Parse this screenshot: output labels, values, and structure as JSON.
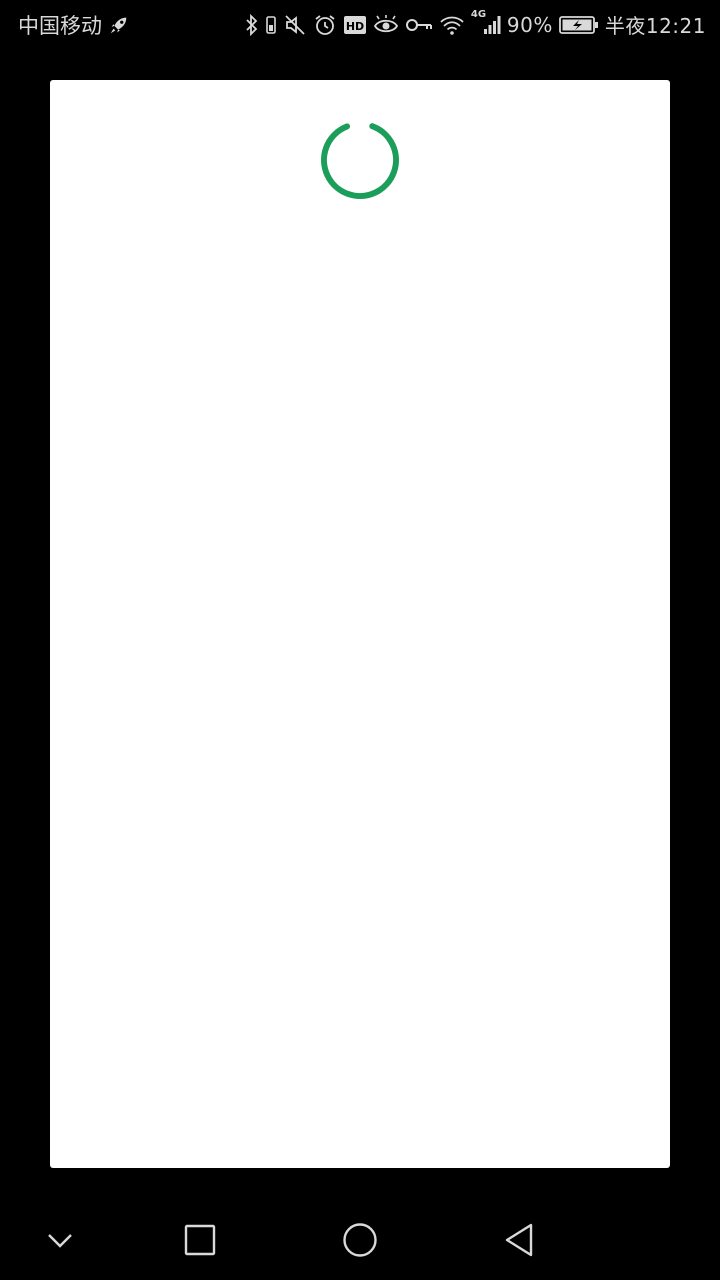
{
  "status_bar": {
    "carrier": "中国移动",
    "network": "4G",
    "battery_percent": "90%",
    "time": "半夜12:21",
    "icons": [
      "rocket-icon",
      "bluetooth-icon",
      "vibrate-icon",
      "mute-icon",
      "alarm-icon",
      "hd-icon",
      "eye-icon",
      "key-icon",
      "wifi-icon",
      "signal-icon",
      "battery-icon"
    ]
  },
  "dialog": {
    "state": "loading",
    "spinner_color": "#1a9e5a"
  },
  "nav_bar": {
    "buttons": [
      "chevron-down-icon",
      "recents-icon",
      "home-icon",
      "back-icon"
    ]
  },
  "colors": {
    "background": "#000000",
    "dialog_bg": "#ffffff",
    "status_text": "#d9d9d9",
    "accent": "#1a9e5a"
  }
}
